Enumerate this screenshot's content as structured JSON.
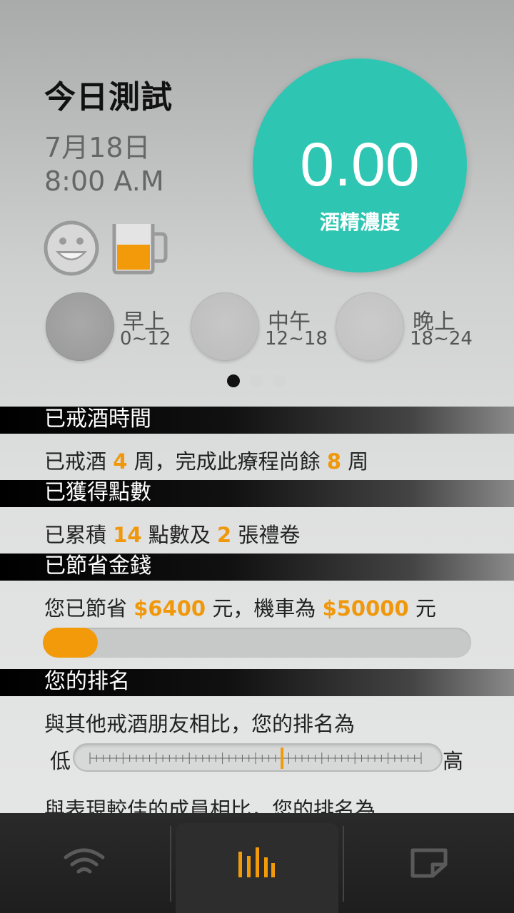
{
  "header": {
    "title": "今日測試",
    "date": "7月18日",
    "time": "8:00 A.M"
  },
  "status": {
    "mood_icon": "smiley-face-icon",
    "drink_icon": "beer-mug-icon",
    "drink_level": 0.55
  },
  "reading": {
    "value": "0.00",
    "label": "酒精濃度",
    "color": "#2ec6b3"
  },
  "periods": [
    {
      "name": "早上",
      "range": "0~12"
    },
    {
      "name": "中午",
      "range": "12~18"
    },
    {
      "name": "晚上",
      "range": "18~24"
    }
  ],
  "pager": {
    "count": 3,
    "active": 0
  },
  "sections": {
    "quit_time": {
      "title": "已戒酒時間",
      "p1": "已戒酒 ",
      "weeks_done": "4",
      "p2": " 周，完成此療程尚餘 ",
      "weeks_left": "8",
      "p3": " 周"
    },
    "points": {
      "title": "已獲得點數",
      "p1": "已累積 ",
      "points": "14",
      "p2": " 點數及 ",
      "vouchers": "2",
      "p3": " 張禮卷"
    },
    "savings": {
      "title": "已節省金錢",
      "p1": "您已節省 ",
      "saved": "$6400",
      "p2": " 元，機車為 ",
      "goal": "$50000",
      "p3": " 元",
      "progress": 0.128
    },
    "ranking": {
      "title": "您的排名",
      "line1": "與其他戒酒朋友相比，您的排名為",
      "low": "低",
      "high": "高",
      "position": 0.58,
      "line2": "與表現較佳的成員相比，您的排名為"
    }
  },
  "accent_color": "#f0980c",
  "nav": {
    "items": [
      {
        "icon": "wifi-icon",
        "active": false
      },
      {
        "icon": "bar-chart-icon",
        "active": true
      },
      {
        "icon": "note-icon",
        "active": false
      }
    ]
  }
}
